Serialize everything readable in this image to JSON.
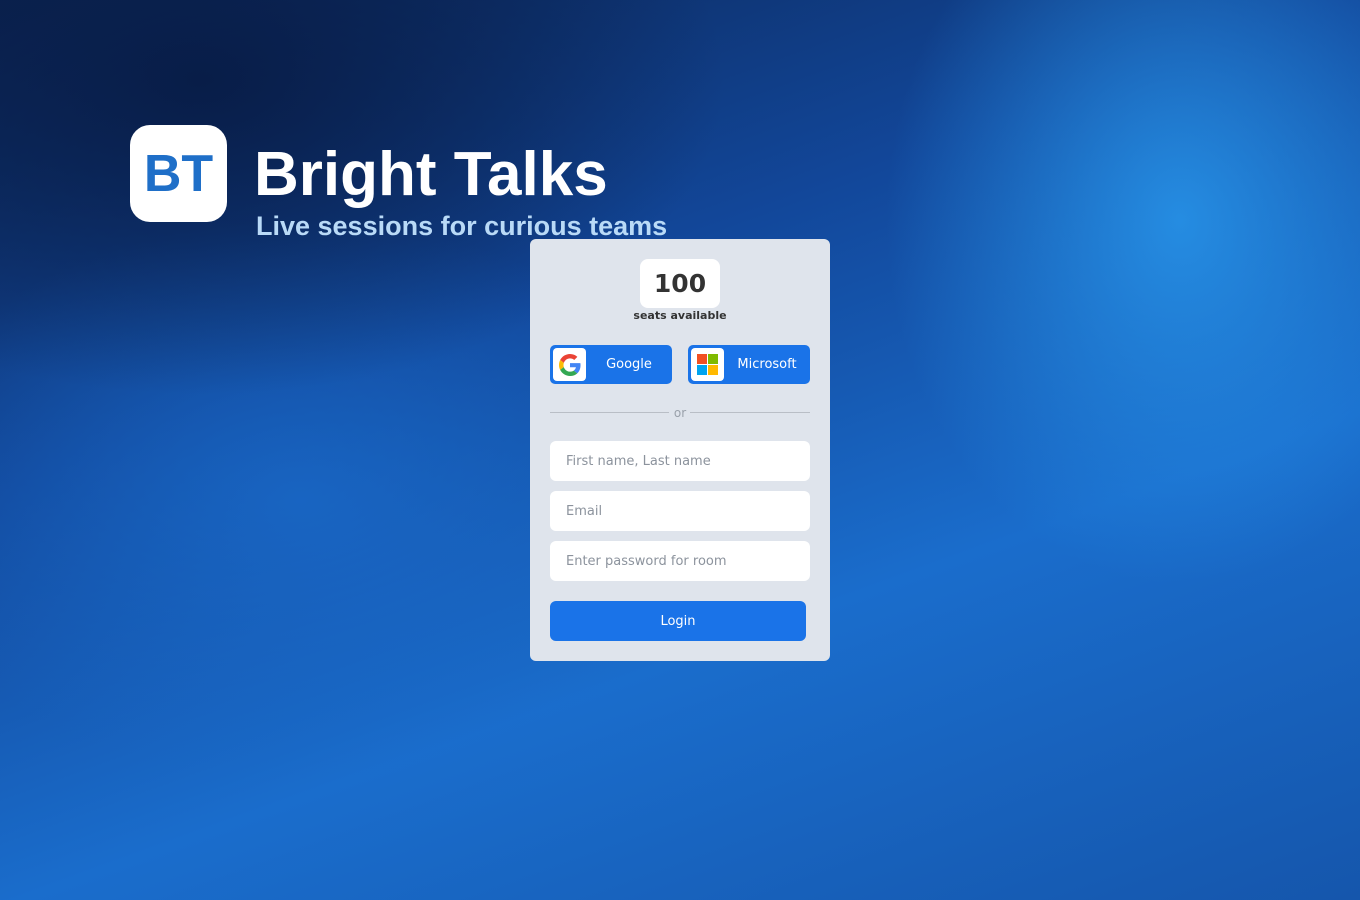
{
  "brand": {
    "logo_text": "BT",
    "title": "Bright Talks",
    "subtitle": "Live sessions for curious teams"
  },
  "login_card": {
    "seats": {
      "count": "100",
      "label": "seats available"
    },
    "sso": {
      "google_label": "Google",
      "google_icon": "google-icon",
      "microsoft_label": "Microsoft",
      "microsoft_icon": "microsoft-icon"
    },
    "divider_text": "or",
    "fields": {
      "name_placeholder": "First name, Last name",
      "name_value": "",
      "email_placeholder": "Email",
      "email_value": "",
      "password_placeholder": "Enter password for room",
      "password_value": ""
    },
    "login_label": "Login"
  },
  "colors": {
    "primary_button": "#1a73e8",
    "card_background": "#dfe4ec",
    "logo_text": "#1f6fc8",
    "subtitle": "#b9daf7"
  }
}
